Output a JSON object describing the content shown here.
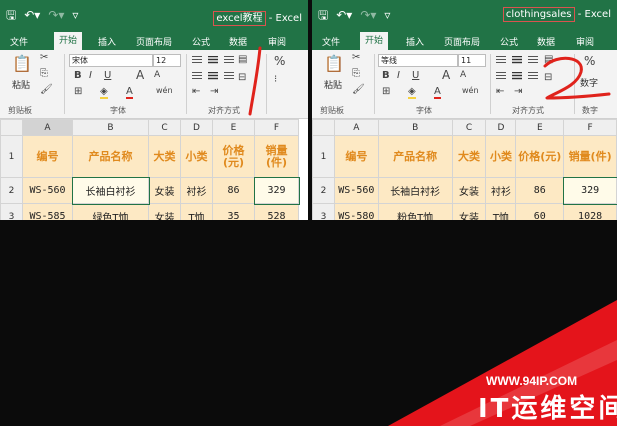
{
  "left_window": {
    "title_file": "excel教程",
    "title_suffix": " - Excel",
    "tabs": [
      "文件",
      "开始",
      "插入",
      "页面布局",
      "公式",
      "数据",
      "审阅"
    ],
    "active_tab": "开始",
    "font_name": "宋体",
    "font_size": "12",
    "groups": [
      "剪贴板",
      "字体",
      "对齐方式"
    ],
    "paste_label": "粘贴",
    "col_headers": [
      "A",
      "B",
      "C",
      "D",
      "E",
      "F"
    ],
    "header_row": [
      "编号",
      "产品名称",
      "大类",
      "小类",
      "价格(元)",
      "销量(件)"
    ],
    "rows": [
      {
        "num": "2",
        "cells": [
          "WS-560",
          "长袖白衬衫",
          "女装",
          "衬衫",
          "86",
          "329"
        ]
      },
      {
        "num": "3",
        "cells": [
          "WS-585",
          "绿色T恤",
          "女装",
          "T恤",
          "35",
          "528"
        ]
      }
    ],
    "row1_num": "1"
  },
  "right_window": {
    "title_file": "clothingsales",
    "title_suffix": " - Excel",
    "tabs": [
      "文件",
      "开始",
      "插入",
      "页面布局",
      "公式",
      "数据",
      "审阅"
    ],
    "active_tab": "开始",
    "font_name": "等线",
    "font_size": "11",
    "groups": [
      "剪贴板",
      "字体",
      "对齐方式",
      "数字"
    ],
    "number_label": "数字",
    "paste_label": "粘贴",
    "col_headers": [
      "A",
      "B",
      "C",
      "D",
      "E",
      "F"
    ],
    "header_row": [
      "编号",
      "产品名称",
      "大类",
      "小类",
      "价格(元)",
      "销量(件)"
    ],
    "rows": [
      {
        "num": "2",
        "cells": [
          "WS-560",
          "长袖白衬衫",
          "女装",
          "衬衫",
          "86",
          "329"
        ]
      },
      {
        "num": "3",
        "cells": [
          "WS-580",
          "粉色T恤",
          "女装",
          "T恤",
          "60",
          "1028"
        ]
      }
    ],
    "row1_num": "1"
  },
  "ribbon_icons": {
    "bold": "B",
    "italic": "I",
    "underline": "U",
    "grow": "A",
    "shrink": "A",
    "percent": "%",
    "font_color": "A",
    "wen": "wén"
  },
  "annotations": {
    "left_mark": "1",
    "right_mark": "2"
  },
  "watermark": {
    "url": "WWW.94IP.COM",
    "name": "IT运维空间"
  },
  "colors": {
    "excel_green": "#217346",
    "header_fill": "#fde9c4",
    "header_text": "#e08a1e",
    "annotation_red": "#e0231c",
    "brand_red": "#e4141b"
  }
}
